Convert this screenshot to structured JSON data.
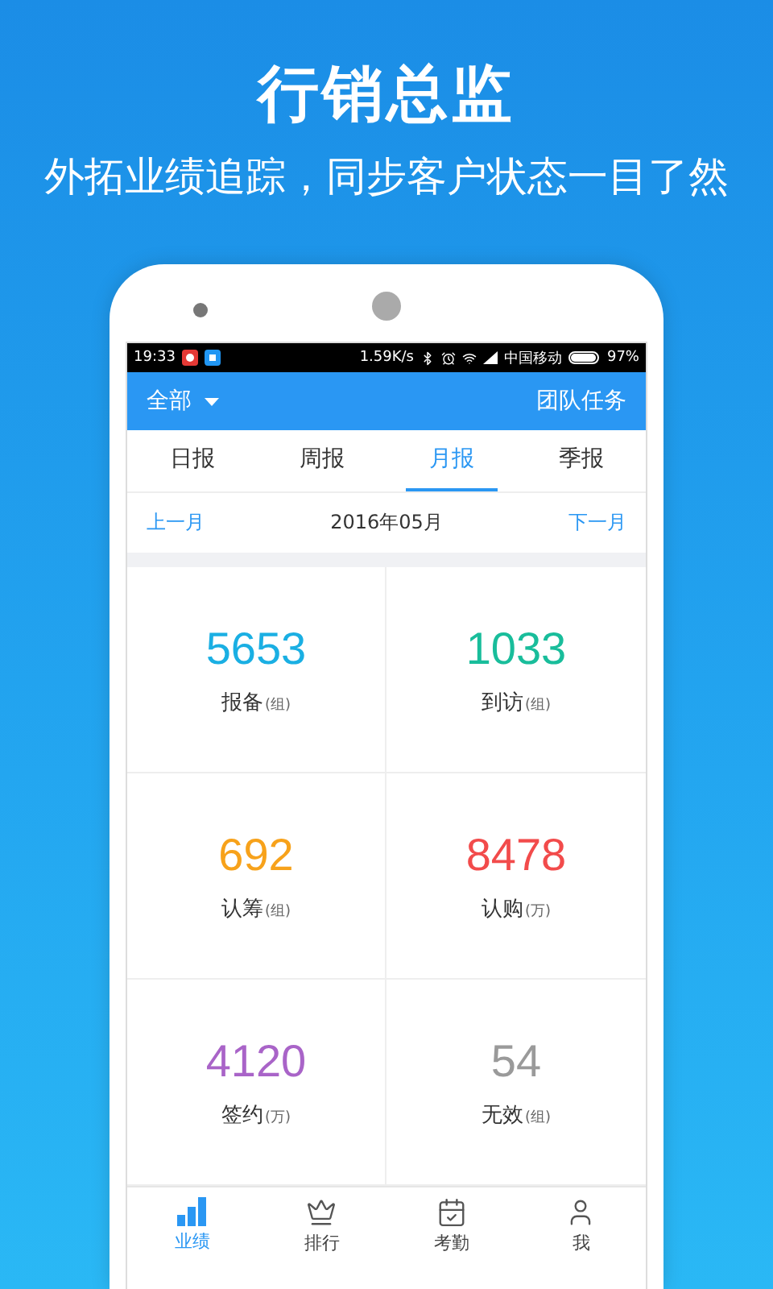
{
  "headline": "行销总监",
  "subtitle": "外拓业绩追踪，同步客户状态一目了然",
  "status_bar": {
    "time": "19:33",
    "speed": "1.59K/s",
    "carrier": "中国移动",
    "battery": "97%",
    "level": 0.97
  },
  "app_bar": {
    "filter": "全部",
    "action": "团队任务"
  },
  "tabs": [
    {
      "label": "日报",
      "selected": false
    },
    {
      "label": "周报",
      "selected": false
    },
    {
      "label": "月报",
      "selected": true
    },
    {
      "label": "季报",
      "selected": false
    }
  ],
  "period": {
    "prev": "上一月",
    "current": "2016年05月",
    "next": "下一月"
  },
  "stats": [
    {
      "value": "5653",
      "label": "报备",
      "unit": "(组)",
      "color": "#1aafe3"
    },
    {
      "value": "1033",
      "label": "到访",
      "unit": "(组)",
      "color": "#19bd9b"
    },
    {
      "value": "692",
      "label": "认筹",
      "unit": "(组)",
      "color": "#f7a21b"
    },
    {
      "value": "8478",
      "label": "认购",
      "unit": "(万)",
      "color": "#f24b4b"
    },
    {
      "value": "4120",
      "label": "签约",
      "unit": "(万)",
      "color": "#a964c8"
    },
    {
      "value": "54",
      "label": "无效",
      "unit": "(组)",
      "color": "#9a9a9a"
    }
  ],
  "bottom_nav": [
    {
      "kind": "chart",
      "label": "业绩",
      "selected": true
    },
    {
      "kind": "crown",
      "label": "排行",
      "selected": false
    },
    {
      "kind": "calendar",
      "label": "考勤",
      "selected": false
    },
    {
      "kind": "user",
      "label": "我",
      "selected": false
    }
  ]
}
